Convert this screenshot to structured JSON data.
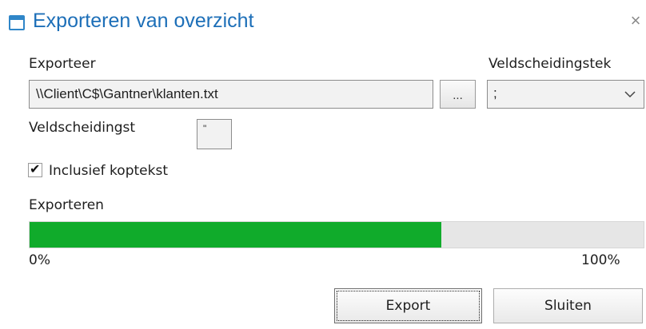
{
  "window": {
    "title": "Exporteren van overzicht",
    "close_glyph": "×",
    "title_icon": "window-icon",
    "accent_color": "#1d6fb8"
  },
  "export": {
    "label": "Exporteer",
    "path_value": "\\\\Client\\C$\\Gantner\\klanten.txt",
    "browse_label": "..."
  },
  "field_separator": {
    "label": "Veldscheidingstek",
    "value": ";",
    "options": [
      ";"
    ]
  },
  "text_qualifier": {
    "label": "Veldscheidingst",
    "value": "\""
  },
  "header_option": {
    "label": "Inclusief koptekst",
    "checked": true,
    "check_glyph": "✔"
  },
  "progress": {
    "label": "Exporteren",
    "min_label": "0%",
    "max_label": "100%",
    "value_percent": 67,
    "fill_color": "#10ab2b"
  },
  "buttons": {
    "export_label": "Export",
    "close_label": "Sluiten"
  }
}
